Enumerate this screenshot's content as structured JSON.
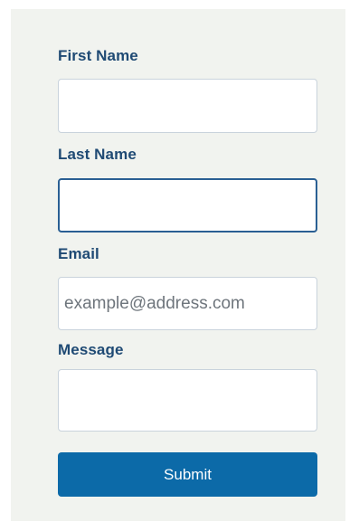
{
  "form": {
    "first_name": {
      "label": "First Name",
      "value": "",
      "placeholder": ""
    },
    "last_name": {
      "label": "Last Name",
      "value": "",
      "placeholder": ""
    },
    "email": {
      "label": "Email",
      "value": "",
      "placeholder": "example@address.com"
    },
    "message": {
      "label": "Message",
      "value": "",
      "placeholder": ""
    },
    "submit_label": "Submit"
  },
  "colors": {
    "panel_background": "#f1f3ef",
    "label_text": "#1f4a74",
    "input_border": "#c9d3dc",
    "focused_border": "#2a5f93",
    "button_background": "#0c6aa8",
    "button_text": "#ffffff"
  }
}
